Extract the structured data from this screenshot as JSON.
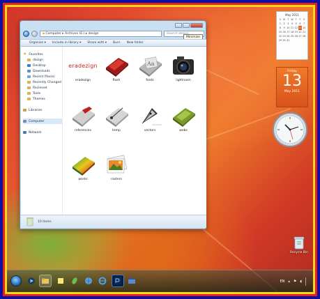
{
  "window": {
    "address_segments": [
      "Computer",
      "Archives (E:)",
      "design"
    ],
    "search_placeholder": "Search design",
    "tooltip": "Minimize",
    "toolbar": [
      "Organize ▾",
      "Include in library ▾",
      "Share with ▾",
      "Burn",
      "New folder"
    ],
    "nav": {
      "favorites": "Favorites",
      "fav_items": [
        "design",
        "Desktop",
        "Downloads",
        "Recent Places",
        "Recently Changed",
        "Recieved",
        "Tools",
        "Themes"
      ],
      "libraries": "Libraries",
      "computer": "Computer",
      "network": "Network"
    },
    "items": [
      {
        "label": "eradezign",
        "icon": "eradezign-logo"
      },
      {
        "label": "flash",
        "icon": "flash-folder"
      },
      {
        "label": "fonts",
        "icon": "fonts-folder"
      },
      {
        "label": "lightroom",
        "icon": "camera-icon"
      },
      {
        "label": "references",
        "icon": "references-folder"
      },
      {
        "label": "temp",
        "icon": "temp-folder"
      },
      {
        "label": "vectors",
        "icon": "pen-nib-icon"
      },
      {
        "label": "webs",
        "icon": "webs-folder"
      },
      {
        "label": "works",
        "icon": "works-folder"
      },
      {
        "label": "rasters",
        "icon": "photos-icon"
      }
    ],
    "logo_text": "eradezign",
    "status": "10 items"
  },
  "calendar": {
    "month_header": "May 2011",
    "weekday_headers": [
      "S",
      "M",
      "T",
      "W",
      "T",
      "F",
      "S"
    ],
    "days": [
      "1",
      "2",
      "3",
      "4",
      "5",
      "6",
      "7",
      "8",
      "9",
      "10",
      "11",
      "12",
      "13",
      "14",
      "15",
      "16",
      "17",
      "18",
      "19",
      "20",
      "21",
      "22",
      "23",
      "24",
      "25",
      "26",
      "27",
      "28",
      "29",
      "30",
      "31"
    ],
    "today": "13",
    "weekday": "Friday",
    "day_number": "13",
    "month_year": "May 2011"
  },
  "recycle_bin": "Recycle Bin",
  "tray": {
    "language": "EN"
  },
  "colors": {
    "frame_blue": "#1010a0",
    "frame_red": "#e8201c",
    "frame_yellow": "#f4d81a",
    "calendar_orange": "#e8641e"
  }
}
